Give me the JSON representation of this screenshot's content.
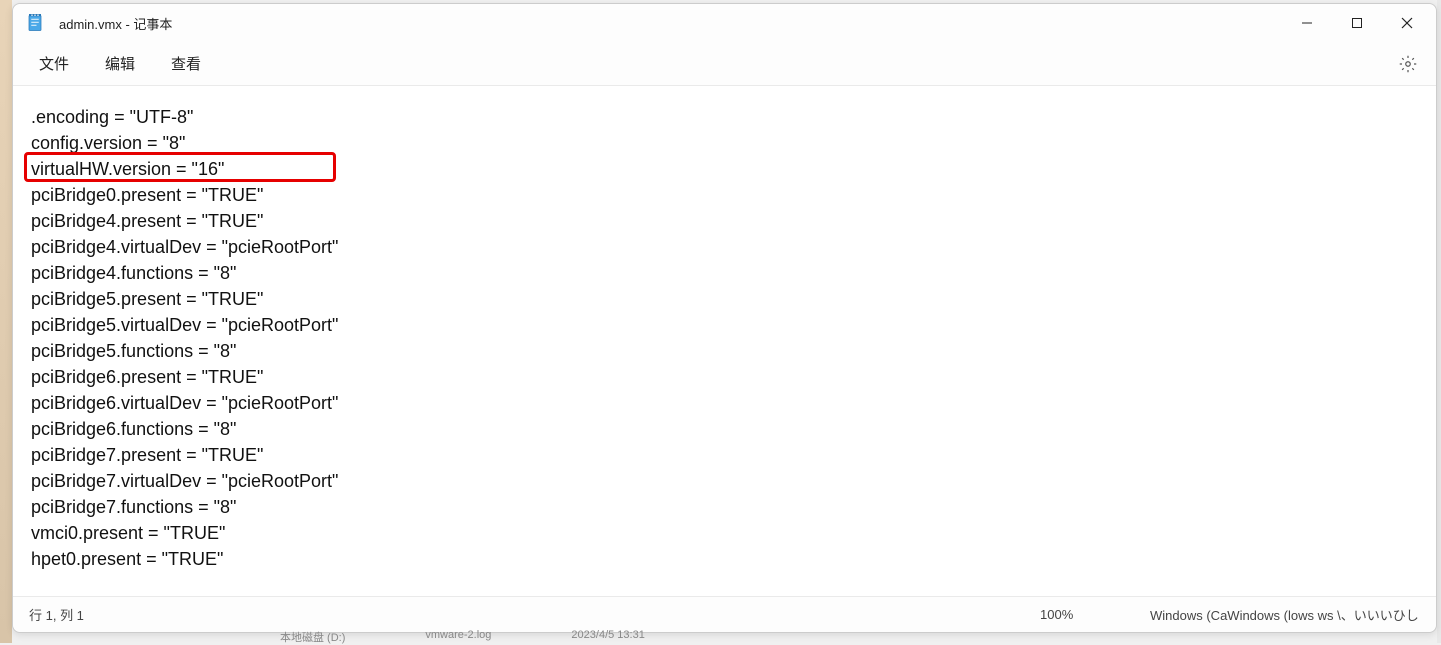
{
  "window": {
    "title": "admin.vmx - 记事本"
  },
  "menu": {
    "file": "文件",
    "edit": "编辑",
    "view": "查看"
  },
  "content": {
    "lines": [
      ".encoding = \"UTF-8\"",
      "config.version = \"8\"",
      "virtualHW.version = \"16\"",
      "pciBridge0.present = \"TRUE\"",
      "pciBridge4.present = \"TRUE\"",
      "pciBridge4.virtualDev = \"pcieRootPort\"",
      "pciBridge4.functions = \"8\"",
      "pciBridge5.present = \"TRUE\"",
      "pciBridge5.virtualDev = \"pcieRootPort\"",
      "pciBridge5.functions = \"8\"",
      "pciBridge6.present = \"TRUE\"",
      "pciBridge6.virtualDev = \"pcieRootPort\"",
      "pciBridge6.functions = \"8\"",
      "pciBridge7.present = \"TRUE\"",
      "pciBridge7.virtualDev = \"pcieRootPort\"",
      "pciBridge7.functions = \"8\"",
      "vmci0.present = \"TRUE\"",
      "hpet0.present = \"TRUE\""
    ],
    "highlight_line_index": 2
  },
  "statusbar": {
    "position": "行 1, 列 1",
    "zoom": "100%",
    "platform": "Windows (CaWindows (lows ws \\、いいいひしろふ"
  },
  "taskbar": {
    "item1": "本地磁盘 (D:)",
    "item2": "vmware-2.log",
    "item3": "2023/4/5 13:31"
  }
}
